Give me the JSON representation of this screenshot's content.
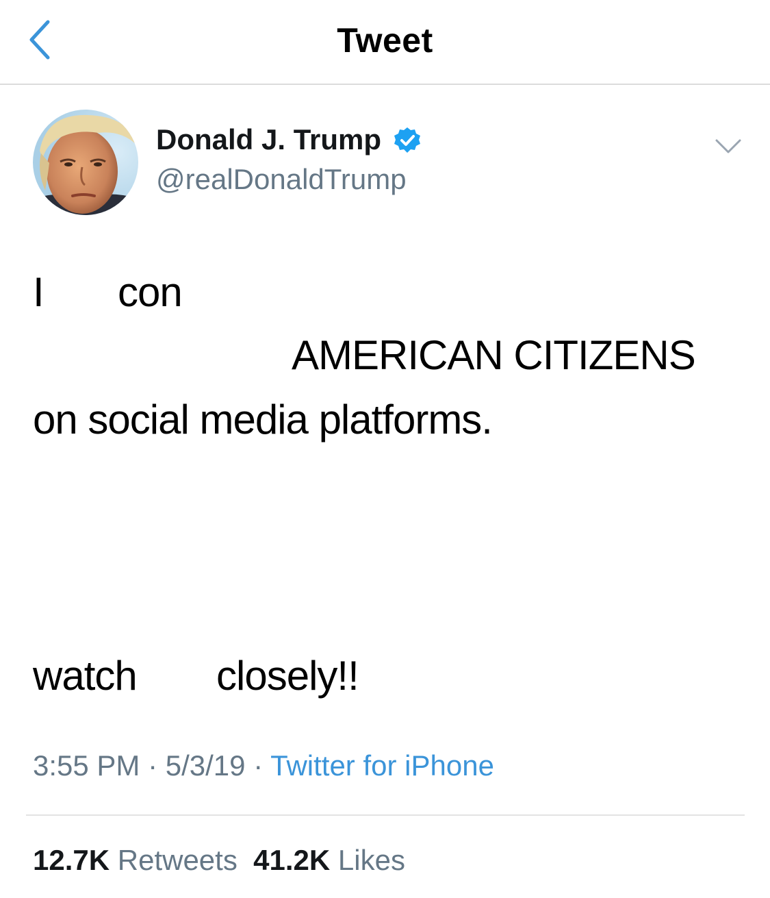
{
  "nav": {
    "title": "Tweet",
    "back_icon": "chevron-left-icon"
  },
  "author": {
    "name": "Donald J. Trump",
    "handle": "@realDonaldTrump",
    "verified_icon": "verified-badge-icon",
    "more_icon": "chevron-down-icon"
  },
  "tweet": {
    "line1_a": "I",
    "line1_b": "con",
    "line2": "AMERICAN CITIZENS",
    "line3": "on social media platforms.",
    "line4_a": "watch",
    "line4_b": "closely!!"
  },
  "meta": {
    "time": "3:55 PM",
    "separator1": " · ",
    "date": "5/3/19",
    "separator2": " · ",
    "source": "Twitter for iPhone"
  },
  "stats": {
    "retweets_count": "12.7K",
    "retweets_label": "Retweets",
    "likes_count": "41.2K",
    "likes_label": "Likes"
  },
  "colors": {
    "accent": "#1da1f2",
    "link": "#3b94d9",
    "secondary_text": "#657786",
    "primary_text": "#14171a"
  }
}
